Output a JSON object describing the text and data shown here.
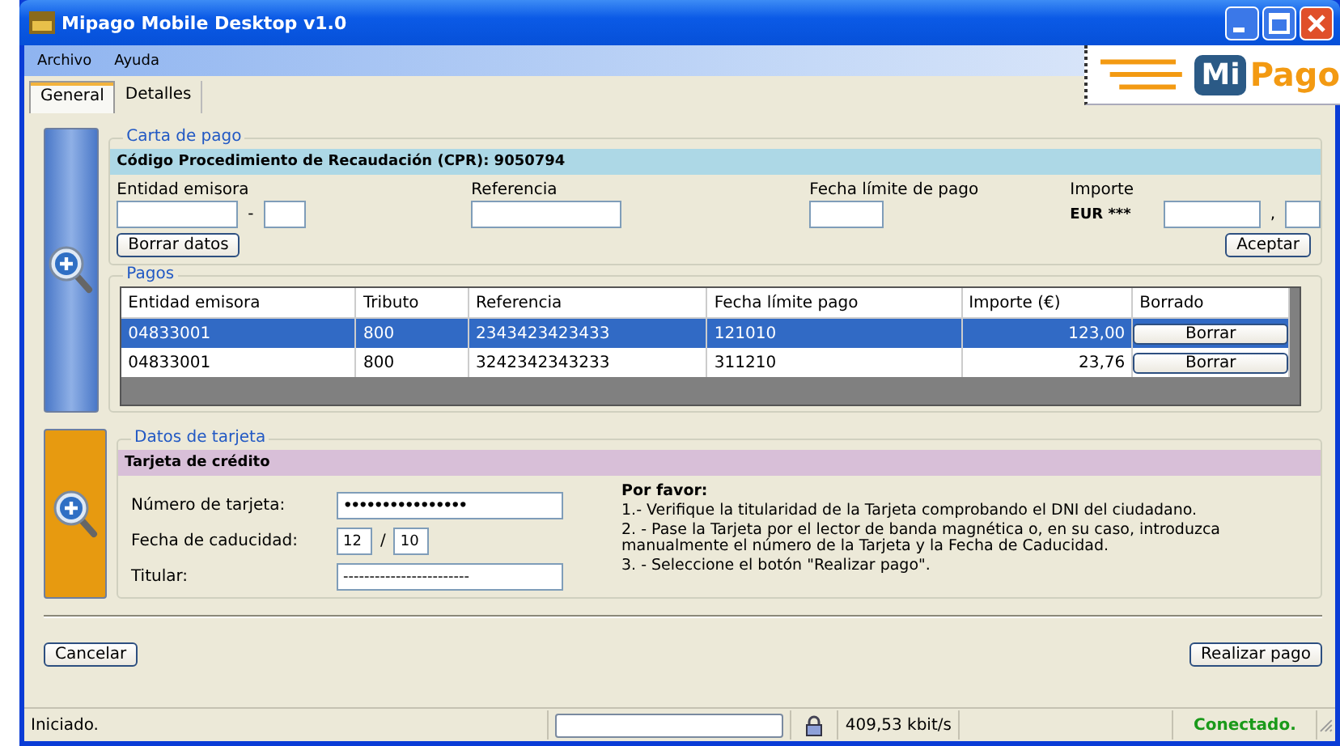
{
  "window": {
    "title": "Mipago Mobile Desktop v1.0"
  },
  "menu": [
    "Archivo",
    "Ayuda"
  ],
  "logo": {
    "mark": "Mi",
    "word": "Pago"
  },
  "tabs": [
    {
      "label": "General",
      "selected": true
    },
    {
      "label": "Detalles",
      "selected": false
    }
  ],
  "carta": {
    "title": "Carta de pago",
    "header": "Código Procedimiento de Recaudación (CPR): 9050794",
    "entidad_label": "Entidad emisora",
    "dash": "-",
    "referencia_label": "Referencia",
    "fecha_label": "Fecha límite de pago",
    "importe_label": "Importe",
    "currency": "EUR ***",
    "comma": ",",
    "clear_button": "Borrar datos",
    "accept_button": "Aceptar"
  },
  "pagos": {
    "title": "Pagos",
    "columns": [
      "Entidad emisora",
      "Tributo",
      "Referencia",
      "Fecha límite pago",
      "Importe (€)",
      "Borrado"
    ],
    "rows": [
      {
        "cells": [
          "04833001",
          "800",
          "2343423423433",
          "121010",
          "123,00"
        ],
        "action": "Borrar",
        "selected": true
      },
      {
        "cells": [
          "04833001",
          "800",
          "3242342343233",
          "311210",
          "23,76"
        ],
        "action": "Borrar",
        "selected": false
      }
    ]
  },
  "tarjeta": {
    "title": "Datos de tarjeta",
    "header": "Tarjeta de crédito",
    "number_label": "Número de tarjeta:",
    "number_value": "••••••••••••••••",
    "expiry_label": "Fecha de caducidad:",
    "expiry_month": "12",
    "expiry_separator": "/",
    "expiry_year": "10",
    "holder_label": "Titular:",
    "holder_value": "------------------------",
    "notes_title": "Por favor:",
    "notes": [
      "1.- Verifique la titularidad de la Tarjeta comprobando el DNI del ciudadano.",
      "2. - Pase la Tarjeta por el lector de banda magnética o, en su caso, introduzca manualmente el número de la Tarjeta y la Fecha de Caducidad.",
      "3. - Seleccione el botón \"Realizar pago\"."
    ]
  },
  "buttons": {
    "cancel": "Cancelar",
    "pay": "Realizar pago"
  },
  "status_bar": {
    "message": "Iniciado.",
    "speed": "409,53 kbit/s",
    "connection": "Conectado."
  }
}
